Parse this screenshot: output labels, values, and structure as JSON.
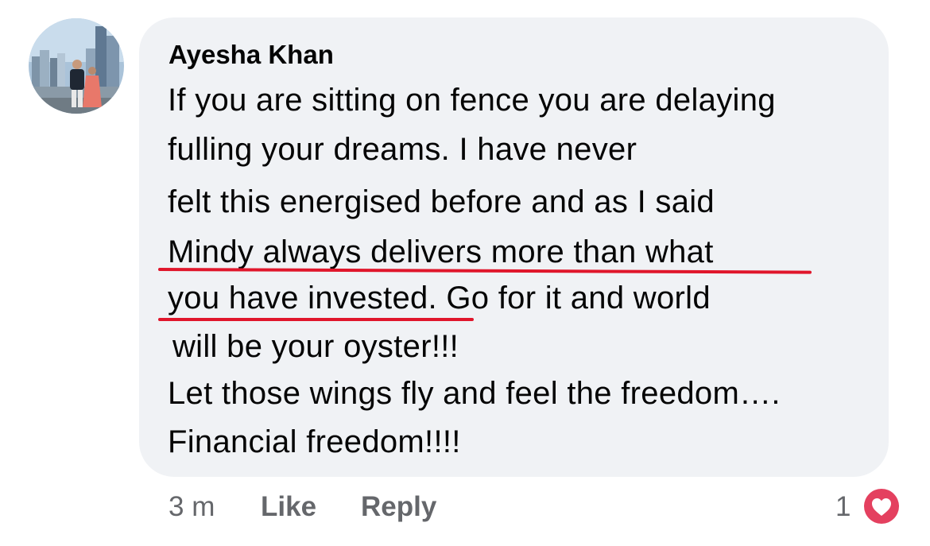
{
  "comment": {
    "author": "Ayesha Khan",
    "lines": [
      "If you are sitting on fence you are delaying",
      "fulling your dreams. I have never",
      "felt this energised before and as I said",
      "Mindy always delivers more than what",
      "you have invested. Go for it and world",
      "will be your oyster!!!",
      "Let those wings fly and feel the freedom….",
      "Financial freedom!!!!"
    ],
    "highlight_color": "#e0162b"
  },
  "actions": {
    "time": "3 m",
    "like_label": "Like",
    "reply_label": "Reply",
    "reaction_count": "1",
    "reaction_icon": "heart-icon",
    "reaction_color": "#e4405f"
  }
}
